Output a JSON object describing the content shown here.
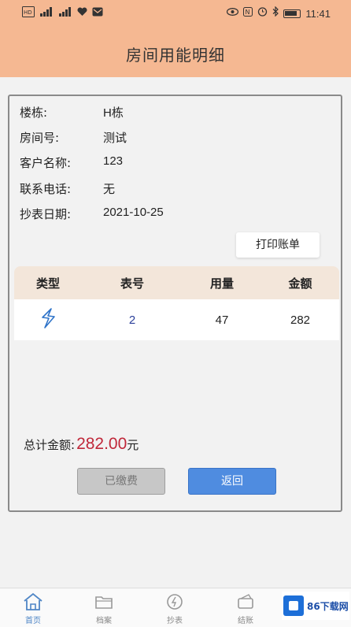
{
  "status_bar": {
    "left_icons": [
      "hd-icon",
      "signal-icon",
      "signal-icon",
      "heart-icon",
      "mail-icon"
    ],
    "right_icons": [
      "eye-icon",
      "nfc-icon",
      "alarm-icon",
      "bluetooth-icon",
      "battery-icon"
    ],
    "time": "11:41"
  },
  "header": {
    "title": "房间用能明细"
  },
  "info": {
    "building_label": "楼栋:",
    "building_value": "H栋",
    "room_label": "房间号:",
    "room_value": "测试",
    "customer_label": "客户名称:",
    "customer_value": "123",
    "phone_label": "联系电话:",
    "phone_value": "无",
    "date_label": "抄表日期:",
    "date_value": "2021-10-25"
  },
  "print_button": "打印账单",
  "table": {
    "headers": [
      "类型",
      "表号",
      "用量",
      "金额"
    ],
    "rows": [
      {
        "type_icon": "electricity-icon",
        "meter": "2",
        "usage": "47",
        "amount": "282"
      }
    ]
  },
  "total": {
    "label": "总计金额:",
    "amount": "282.00",
    "unit": "元"
  },
  "buttons": {
    "paid": "已缴费",
    "back": "返回"
  },
  "bottom_nav": [
    {
      "label": "首页",
      "icon": "home-icon"
    },
    {
      "label": "档案",
      "icon": "folder-icon"
    },
    {
      "label": "抄表",
      "icon": "meter-reading-icon"
    },
    {
      "label": "结账",
      "icon": "checkout-icon"
    }
  ],
  "watermark": {
    "text": "86下载网"
  },
  "colors": {
    "header_bg": "#f5b892",
    "table_header_bg": "#f3e6da",
    "total_amount": "#c0283a",
    "back_button": "#4f8ce0",
    "paid_button": "#c7c7c7"
  }
}
